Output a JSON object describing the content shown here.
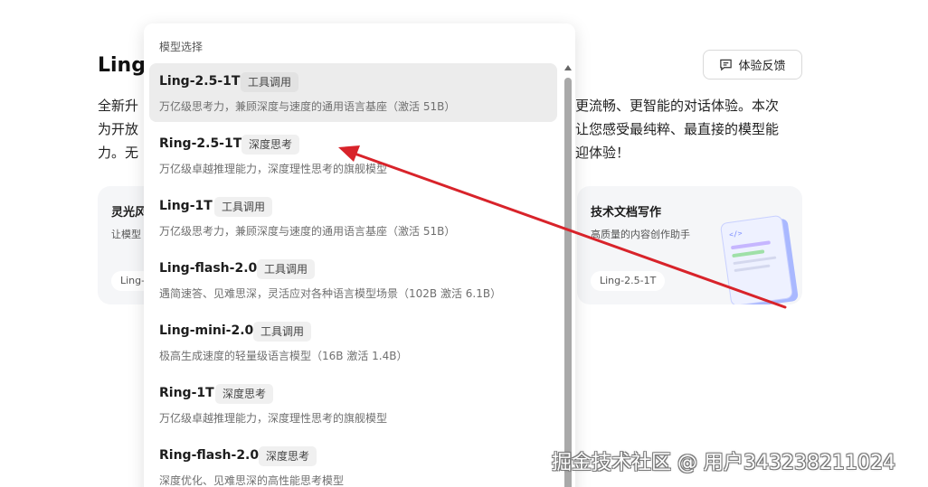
{
  "page": {
    "title": "Ling",
    "feedback_label": "体验反馈",
    "desc_left": [
      "全新升",
      "为开放",
      "力。无"
    ],
    "desc_right": [
      "更流畅、更智能的对话体验。本次",
      "让您感受最纯粹、最直接的模型能",
      "迎体验！"
    ]
  },
  "cards": {
    "left": {
      "title": "灵光风",
      "subtitle": "让模型",
      "tag": "Ling-"
    },
    "right": {
      "title": "技术文档写作",
      "subtitle": "高质量的内容创作助手",
      "tag": "Ling-2.5-1T"
    }
  },
  "dropdown": {
    "header": "模型选择",
    "models": [
      {
        "name": "Ling-2.5-1T",
        "badge": "工具调用",
        "desc": "万亿级思考力，兼顾深度与速度的通用语言基座（激活 51B）",
        "selected": true
      },
      {
        "name": "Ring-2.5-1T",
        "badge": "深度思考",
        "desc": "万亿级卓越推理能力，深度理性思考的旗舰模型",
        "selected": false
      },
      {
        "name": "Ling-1T",
        "badge": "工具调用",
        "desc": "万亿级思考力，兼顾深度与速度的通用语言基座（激活 51B）",
        "selected": false
      },
      {
        "name": "Ling-flash-2.0",
        "badge": "工具调用",
        "desc": "遇简速答、见难思深，灵活应对各种语言模型场景（102B 激活 6.1B）",
        "selected": false
      },
      {
        "name": "Ling-mini-2.0",
        "badge": "工具调用",
        "desc": "极高生成速度的轻量级语言模型（16B 激活 1.4B）",
        "selected": false
      },
      {
        "name": "Ring-1T",
        "badge": "深度思考",
        "desc": "万亿级卓越推理能力，深度理性思考的旗舰模型",
        "selected": false
      },
      {
        "name": "Ring-flash-2.0",
        "badge": "深度思考",
        "desc": "深度优化、见难思深的高性能思考模型",
        "selected": false
      }
    ]
  },
  "watermark": "掘金技术社区 @ 用户343238211024",
  "colors": {
    "annotation_arrow": "#d8232a",
    "selected_row": "#ececec"
  }
}
